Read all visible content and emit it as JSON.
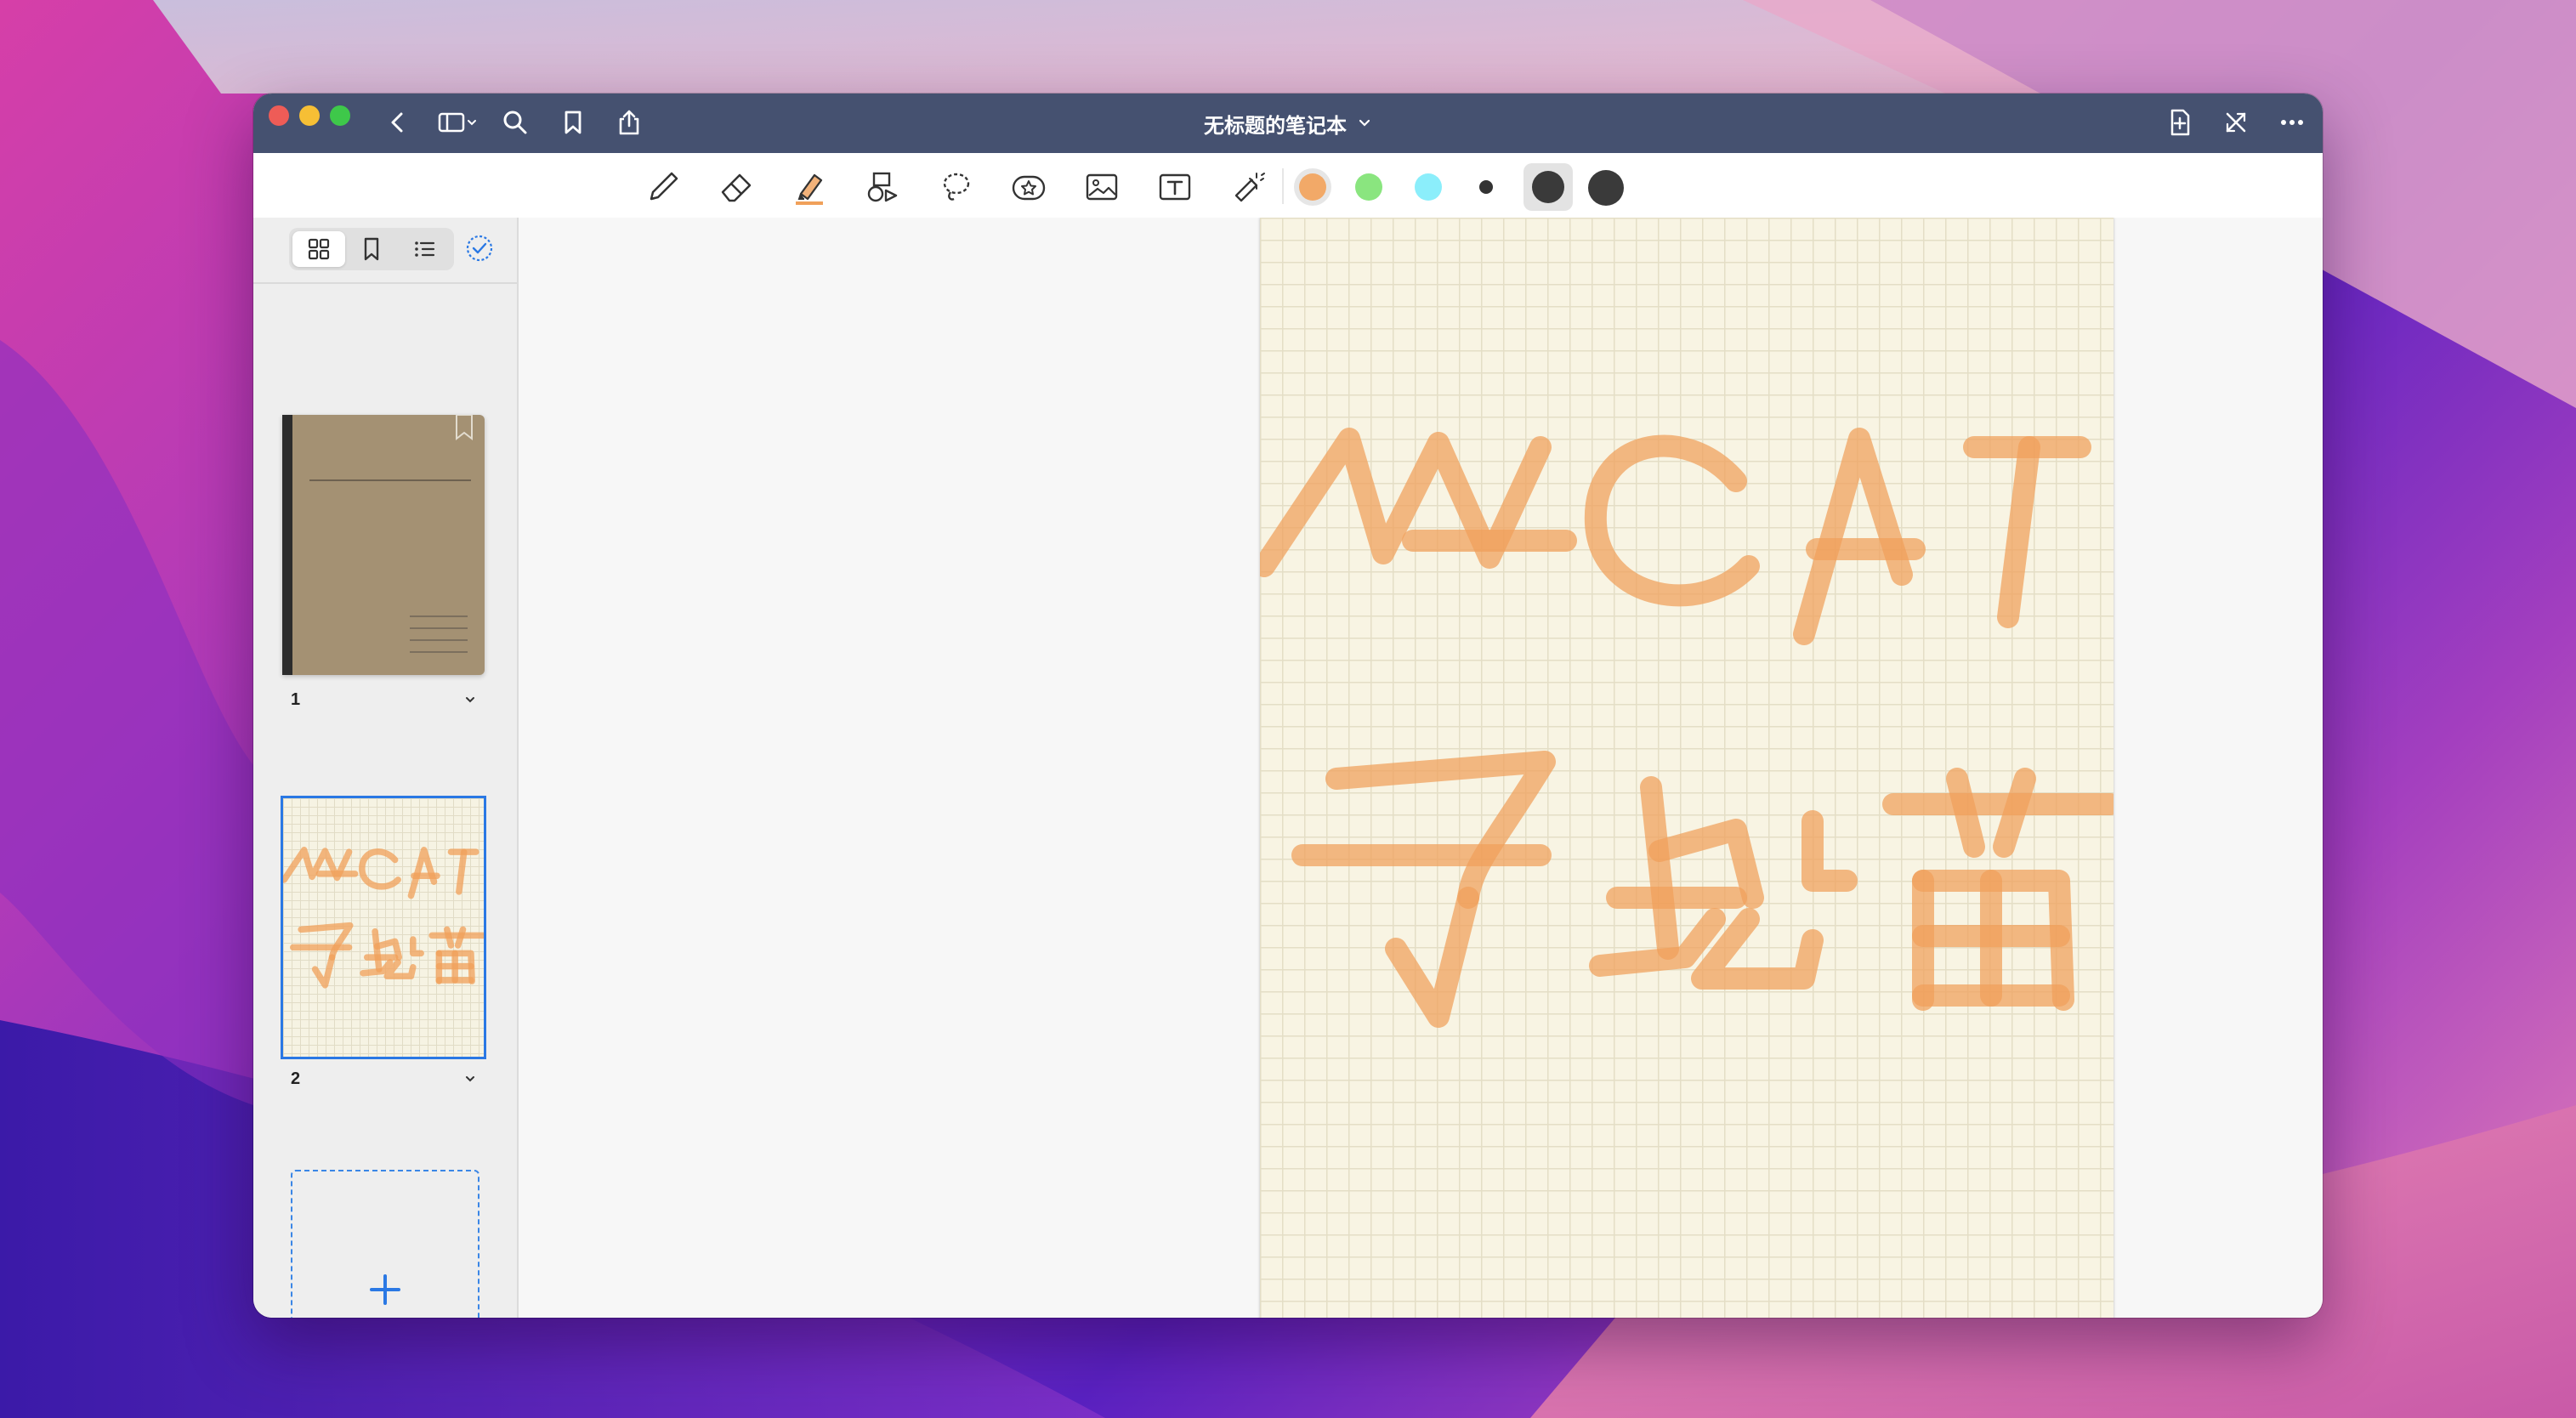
{
  "window": {
    "title": "无标题的笔记本",
    "accent": "#2a78e4",
    "titlebar_color": "#455170"
  },
  "titlebar": {
    "left_icons": [
      "back-icon",
      "sidebar-toggle-icon",
      "search-icon",
      "bookmark-icon",
      "share-icon"
    ],
    "right_icons": [
      "add-page-icon",
      "close-fullscreen-icon",
      "more-icon"
    ]
  },
  "toolbar": {
    "tools": [
      "pen-icon",
      "eraser-icon",
      "highlighter-icon",
      "shapes-icon",
      "lasso-icon",
      "sticker-icon",
      "image-icon",
      "text-icon",
      "laser-pointer-icon"
    ],
    "selected_tool": "highlighter-icon",
    "colors": [
      "#f2a968",
      "#8ae57f",
      "#8beefb"
    ],
    "selected_color": "#f2a968",
    "stroke_sizes": [
      "small",
      "medium",
      "large"
    ],
    "selected_size": "medium"
  },
  "sidebar": {
    "view_modes": [
      "grid-view-icon",
      "bookmarks-icon",
      "outline-icon"
    ],
    "active_view": "grid-view-icon",
    "pages": [
      {
        "number": "1",
        "type": "cover"
      },
      {
        "number": "2",
        "type": "grid-page",
        "selected": true
      }
    ],
    "add_page_label": "+"
  },
  "canvas": {
    "paper_color": "#f8f4e3",
    "ink_color": "#f0a05a"
  }
}
